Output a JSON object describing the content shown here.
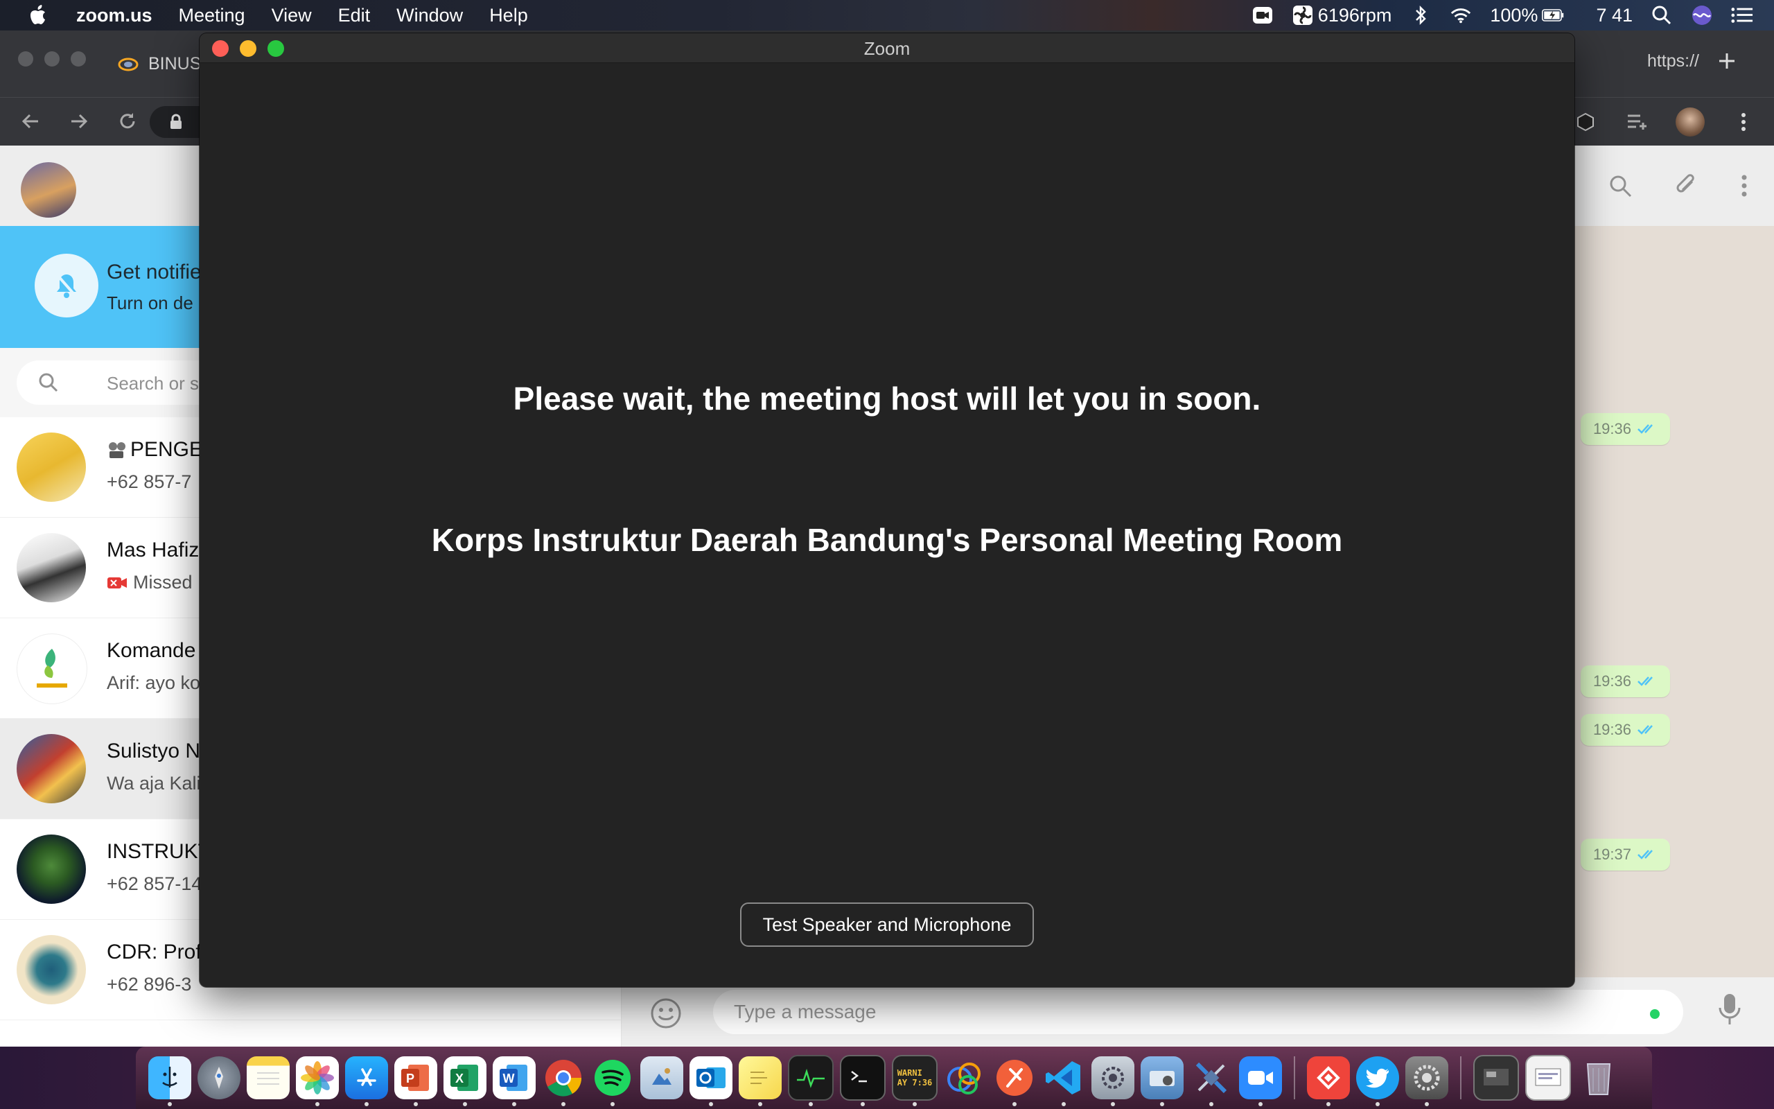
{
  "menubar": {
    "app_name": "zoom.us",
    "menus": [
      "Meeting",
      "View",
      "Edit",
      "Window",
      "Help"
    ],
    "fan_speed": "6196rpm",
    "battery": "100%",
    "clock": "7 41"
  },
  "browser": {
    "tab_title": "BINUS",
    "tab_right_url": "https://"
  },
  "whatsapp": {
    "banner_title": "Get notifie",
    "banner_sub": "Turn on de",
    "search_placeholder": "Search or s",
    "chats": [
      {
        "name": "PENGE",
        "msg": "+62 857-7"
      },
      {
        "name": "Mas Hafiz",
        "msg": "Missed"
      },
      {
        "name": "Komande",
        "msg": "Arif: ayo ko"
      },
      {
        "name": "Sulistyo N",
        "msg": "Wa aja Kali"
      },
      {
        "name": "INSTRUKT",
        "msg": "+62 857-14"
      },
      {
        "name": "CDR: Prof",
        "msg": "+62 896-3"
      }
    ],
    "bubble_times": [
      "19:36",
      "19:36",
      "19:36",
      "19:37"
    ],
    "message_placeholder": "Type a message"
  },
  "zoom": {
    "window_title": "Zoom",
    "wait_message": "Please wait, the meeting host will let you in soon.",
    "room_name": "Korps Instruktur Daerah Bandung's Personal Meeting Room",
    "test_button": "Test Speaker and Microphone"
  },
  "dock": {
    "apps": [
      "finder-icon",
      "launchpad-icon",
      "notes-icon",
      "photos-icon",
      "app-store-icon",
      "powerpoint-icon",
      "excel-icon",
      "word-icon",
      "chrome-icon",
      "spotify-icon",
      "preview-icon",
      "outlook-icon",
      "stickies-icon",
      "activity-monitor-icon",
      "terminal-icon",
      "console-icon",
      "sketch-icon",
      "paw-icon",
      "vscode-icon",
      "system-info-icon",
      "image-capture-icon",
      "satellite-icon",
      "zoom-icon",
      "anydesk-icon",
      "twitter-icon",
      "system-preferences-icon",
      "screen-capture-icon",
      "window-icon",
      "trash-icon"
    ],
    "console_text": "WARNI\nAY 7:36"
  },
  "colors": {
    "zoom_bg": "#232323",
    "wa_banner": "#4fc3f7",
    "wa_bubble": "#dcf8c6",
    "traffic_red": "#fe5f57",
    "traffic_yellow": "#febc2e",
    "traffic_green": "#28c840"
  }
}
